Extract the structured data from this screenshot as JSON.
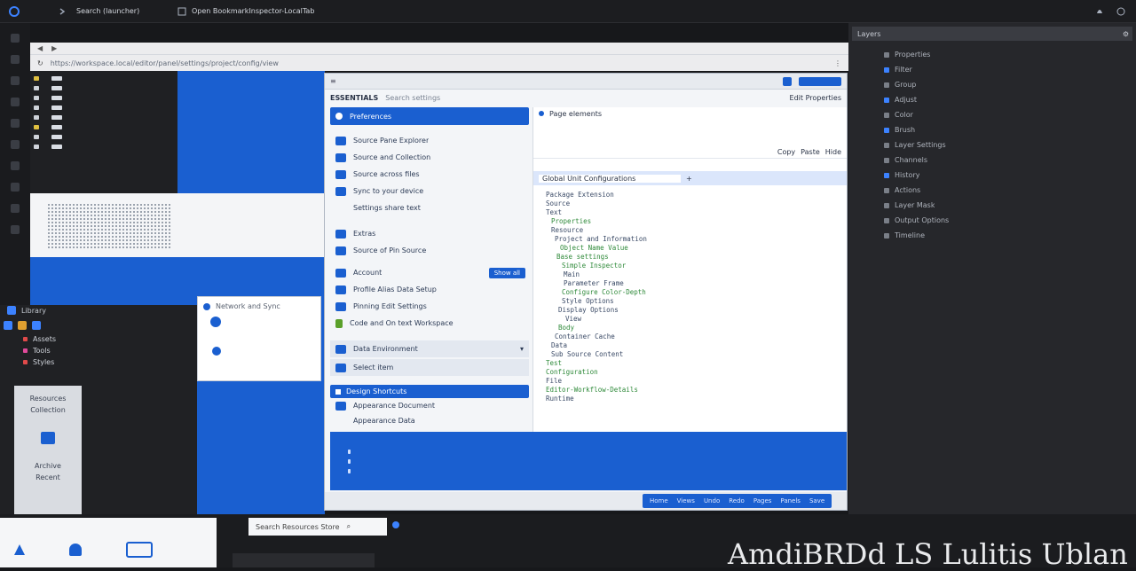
{
  "colors": {
    "accent": "#1a5fd0",
    "dark": "#17181b",
    "panel": "#26272b",
    "light": "#f3f5f8",
    "code_green": "#2f8a3a"
  },
  "menubar": {
    "items": [
      "Search (launcher)",
      "Open BookmarkInspector-LocalTab"
    ],
    "icons": [
      "app-logo-icon",
      "chevron-icon",
      "window-icon",
      "bell-icon",
      "battery-icon",
      "wifi-icon",
      "clock-icon"
    ]
  },
  "browser": {
    "address": "https://workspace.local/editor/panel/settings/project/config/view"
  },
  "mainwin": {
    "title": "ESSENTIALS",
    "search_label": "Search settings",
    "tab_active": "Edit Properties",
    "sidebar": {
      "header": "Preferences",
      "items": [
        "Source Pane Explorer",
        "Source and Collection",
        "Source across files",
        "Sync to your device",
        "Settings share text",
        "Extras",
        "Source of Pin Source",
        "Account",
        "Profile Alias Data Setup",
        "Pinning Edit Settings",
        "Code and On text Workspace"
      ],
      "select_a": "Data Environment",
      "select_b": "Select item",
      "group_header": "Design Shortcuts",
      "sub_a": "Appearance Document",
      "sub_b": "Appearance Data",
      "badge": "Show all"
    },
    "code": {
      "header": "Page elements",
      "field_label": "Global Unit Configurations",
      "toolbar_labels": [
        "Copy",
        "Paste",
        "Hide"
      ],
      "lines": [
        "Package Extension",
        "Source",
        "Text",
        "Properties",
        "Resource",
        "Project and Information",
        "Object Name Value",
        "Base settings",
        "Simple Inspector",
        "Main",
        "Parameter Frame",
        "Configure Color-Depth",
        "Style Options",
        "Display Options",
        "View",
        "Body",
        "Container Cache",
        "Data",
        "Sub Source Content",
        "Test",
        "Configuration",
        "File",
        "Editor-Workflow-Details",
        "Runtime"
      ]
    },
    "statusbar": [
      "Home",
      "Views",
      "Undo",
      "Redo",
      "Pages",
      "Panels",
      "Save"
    ]
  },
  "rightpanel": {
    "header": "Layers",
    "rows": [
      "Properties",
      "Filter",
      "Group",
      "Adjust",
      "Color",
      "Brush",
      "Layer Settings",
      "Channels",
      "History",
      "Actions",
      "Layer Mask",
      "Output Options",
      "Timeline"
    ]
  },
  "leftpanel": {
    "title": "Library",
    "items": [
      "Assets",
      "Tools",
      "Styles"
    ],
    "lightbox_a": "Resources",
    "lightbox_b": "Collection",
    "lightbox_c": "Archive",
    "lightbox_d": "Recent"
  },
  "wincard": {
    "title": "Network and Sync"
  },
  "bottom": {
    "search_text": "Search Resources Store",
    "banner": "AmdiBRDd LS Lulitis Ublan"
  }
}
